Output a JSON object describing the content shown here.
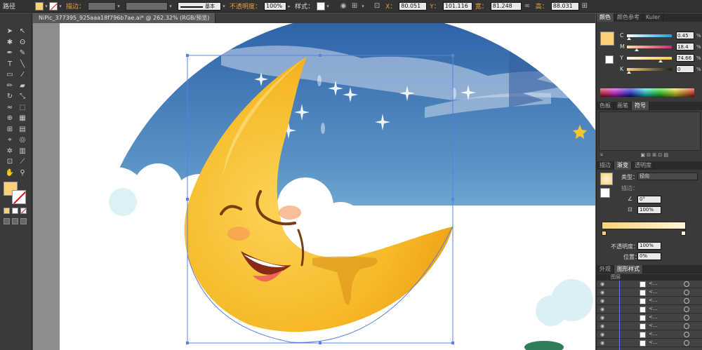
{
  "control_bar": {
    "object_type": "路径",
    "stroke_label": "描边：",
    "stroke_style": "基本",
    "opacity_label": "不透明度：",
    "opacity_value": "100%",
    "style_label": "样式：",
    "x_label": "X：",
    "x_value": "80.051",
    "y_label": "Y：",
    "y_value": "101.116",
    "w_label": "宽：",
    "w_value": "81.248",
    "h_label": "高：",
    "h_value": "88.031",
    "fill_color": "#fbd176"
  },
  "document": {
    "tab_title": "NiPic_377395_925aaa18f796b7ae.ai* @ 262.32% (RGB/预览)"
  },
  "color_panel": {
    "tabs": [
      "颜色",
      "颜色参考",
      "Kuler"
    ],
    "active_tab": "颜色",
    "channels": [
      {
        "key": "C",
        "value": "0.45",
        "fill": 0.0045
      },
      {
        "key": "M",
        "value": "18.4",
        "fill": 0.184
      },
      {
        "key": "Y",
        "value": "74.66",
        "fill": 0.7466
      },
      {
        "key": "K",
        "value": "0",
        "fill": 0
      }
    ],
    "percent": "%"
  },
  "swatch_panel": {
    "tabs": [
      "色板",
      "画笔",
      "符号"
    ],
    "active_tab": "符号"
  },
  "gradient_panel": {
    "tabs": [
      "描边",
      "渐变",
      "透明度"
    ],
    "active_tab": "渐变",
    "type_label": "类型：",
    "type_value": "径向",
    "stroke_label": "描边：",
    "angle_value": "0°",
    "aspect_value": "100%",
    "opacity_label": "不透明度：",
    "opacity_value": "100%",
    "position_label": "位置：",
    "position_value": "0%",
    "start_color": "#fbd176",
    "end_color": "#fff6d8"
  },
  "appearance_panel": {
    "tabs": [
      "外观",
      "图形样式"
    ],
    "active_tab": "图形样式",
    "sub_tab": "图层",
    "layer_label": "<..."
  }
}
